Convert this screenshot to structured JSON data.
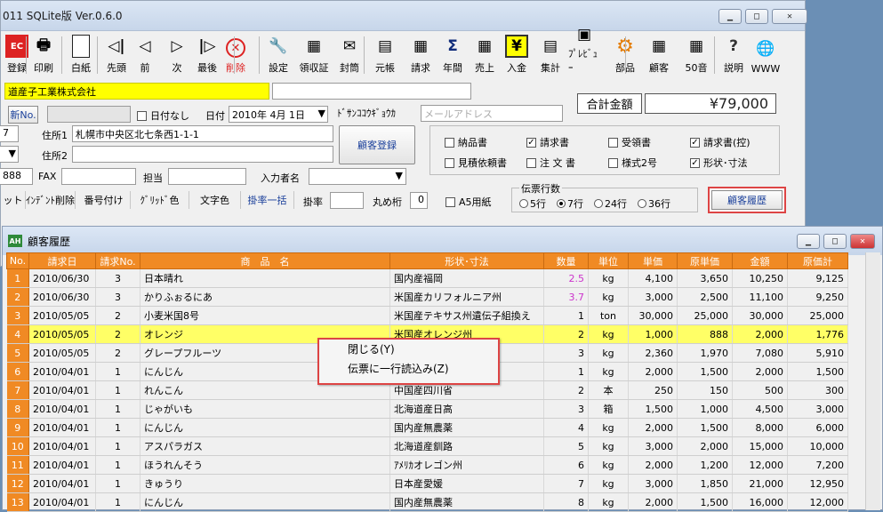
{
  "main_window": {
    "title": "011 SQLite版 Ver.0.6.0",
    "controls": [
      "▁",
      "□",
      "✕"
    ]
  },
  "toolbar": [
    {
      "label": "登録",
      "icon": "ec-register-icon",
      "glyph": "EC"
    },
    {
      "label": "印刷",
      "icon": "printer-icon",
      "glyph": "🖶"
    },
    {
      "label": "白紙",
      "icon": "blank-page-icon",
      "glyph": ""
    },
    {
      "label": "先頭",
      "icon": "first-arrow-icon",
      "glyph": "◁|"
    },
    {
      "label": "前",
      "icon": "prev-arrow-icon",
      "glyph": "◁"
    },
    {
      "label": "次",
      "icon": "next-arrow-icon",
      "glyph": "▷"
    },
    {
      "label": "最後",
      "icon": "last-arrow-icon",
      "glyph": "|▷"
    },
    {
      "label": "削除",
      "icon": "delete-icon",
      "glyph": "✕"
    },
    {
      "label": "設定",
      "icon": "wrench-icon",
      "glyph": "🔧"
    },
    {
      "label": "領収証",
      "icon": "receipt-icon",
      "glyph": "▦"
    },
    {
      "label": "封筒",
      "icon": "envelope-icon",
      "glyph": "✉"
    },
    {
      "label": "元帳",
      "icon": "ledger-icon",
      "glyph": "▤"
    },
    {
      "label": "請求",
      "icon": "invoice-icon",
      "glyph": "▦"
    },
    {
      "label": "年間",
      "icon": "sigma-icon",
      "glyph": "Σ"
    },
    {
      "label": "売上",
      "icon": "sales-icon",
      "glyph": "▦"
    },
    {
      "label": "入金",
      "icon": "yen-icon",
      "glyph": "¥"
    },
    {
      "label": "集計",
      "icon": "total-icon",
      "glyph": "▤"
    },
    {
      "label": "ﾌﾟﾚﾋﾞｭｰ",
      "icon": "preview-icon",
      "glyph": "▣"
    },
    {
      "label": "部品",
      "icon": "gear-icon",
      "glyph": "⚙"
    },
    {
      "label": "顧客",
      "icon": "customer-icon",
      "glyph": "▦"
    },
    {
      "label": "50音",
      "icon": "kana-icon",
      "glyph": "▦"
    },
    {
      "label": "説明",
      "icon": "help-icon",
      "glyph": "?"
    },
    {
      "label": "WWW",
      "icon": "globe-icon",
      "glyph": "🌐"
    }
  ],
  "form": {
    "company": "道産子工業株式会社",
    "company2": "",
    "shinki_btn": "新No.",
    "no_date_label": "日付なし",
    "date_label": "日付",
    "date_value": "2010年 4月 1日",
    "kana": "ﾄﾞｻﾝｺｺｳｷﾞｮｳｶ",
    "email_placeholder": "メールアドレス",
    "total_label": "合計金額",
    "total_value": "¥79,000",
    "postal_partial": "7",
    "addr1_label": "住所1",
    "addr1": "札幌市中央区北七条西1-1-1",
    "addr2_label": "住所2",
    "addr2": "",
    "tel_partial": "888",
    "fax_label": "FAX",
    "tanto_label": "担当",
    "inputter_label": "入力者名",
    "register_customer_btn": "顧客登録",
    "doc_checks": [
      {
        "label": "納品書",
        "checked": false
      },
      {
        "label": "請求書",
        "checked": true
      },
      {
        "label": "受領書",
        "checked": false
      },
      {
        "label": "請求書(控)",
        "checked": true
      },
      {
        "label": "見積依頼書",
        "checked": false
      },
      {
        "label": "注 文 書",
        "checked": false
      },
      {
        "label": "様式2号",
        "checked": false
      },
      {
        "label": "形状･寸法",
        "checked": true
      }
    ],
    "small_buttons": [
      "ット",
      "ｲﾝﾃﾞﾝﾄ削除",
      "番号付け",
      "ｸﾞﾘｯﾄﾞ色",
      "文字色",
      "掛率一括"
    ],
    "rate_label": "掛率",
    "round_label": "丸め桁",
    "round_value": "0",
    "a5_label": "A5用紙",
    "lines_group_label": "伝票行数",
    "lines_options": [
      {
        "label": "5行",
        "selected": false
      },
      {
        "label": "7行",
        "selected": true
      },
      {
        "label": "24行",
        "selected": false
      },
      {
        "label": "36行",
        "selected": false
      }
    ],
    "history_btn": "顧客履歴"
  },
  "history_window": {
    "title": "顧客履歴",
    "app_icon": "AH",
    "columns": [
      "No.",
      "請求日",
      "請求No.",
      "商　品　名",
      "形状･寸法",
      "数量",
      "単位",
      "単価",
      "原単価",
      "金額",
      "原価計"
    ],
    "rows": [
      [
        "1",
        "2010/06/30",
        "3",
        "日本晴れ",
        "国内産福岡",
        "2.5",
        "kg",
        "4,100",
        "3,650",
        "10,250",
        "9,125"
      ],
      [
        "2",
        "2010/06/30",
        "3",
        "かりふぉるにあ",
        "米国産カリフォルニア州",
        "3.7",
        "kg",
        "3,000",
        "2,500",
        "11,100",
        "9,250"
      ],
      [
        "3",
        "2010/05/05",
        "2",
        "小麦米国8号",
        "米国産テキサス州遺伝子組換え",
        "1",
        "ton",
        "30,000",
        "25,000",
        "30,000",
        "25,000"
      ],
      [
        "4",
        "2010/05/05",
        "2",
        "オレンジ",
        "米国産オレンジ州",
        "2",
        "kg",
        "1,000",
        "888",
        "2,000",
        "1,776"
      ],
      [
        "5",
        "2010/05/05",
        "2",
        "グレープフルーツ",
        "",
        "3",
        "kg",
        "2,360",
        "1,970",
        "7,080",
        "5,910"
      ],
      [
        "6",
        "2010/04/01",
        "1",
        "にんじん",
        "",
        "1",
        "kg",
        "2,000",
        "1,500",
        "2,000",
        "1,500"
      ],
      [
        "7",
        "2010/04/01",
        "1",
        "れんこん",
        "中国産四川省",
        "2",
        "本",
        "250",
        "150",
        "500",
        "300"
      ],
      [
        "8",
        "2010/04/01",
        "1",
        "じゃがいも",
        "北海道産日高",
        "3",
        "箱",
        "1,500",
        "1,000",
        "4,500",
        "3,000"
      ],
      [
        "9",
        "2010/04/01",
        "1",
        "にんじん",
        "国内産無農薬",
        "4",
        "kg",
        "2,000",
        "1,500",
        "8,000",
        "6,000"
      ],
      [
        "10",
        "2010/04/01",
        "1",
        "アスパラガス",
        "北海道産釧路",
        "5",
        "kg",
        "3,000",
        "2,000",
        "15,000",
        "10,000"
      ],
      [
        "11",
        "2010/04/01",
        "1",
        "ほうれんそう",
        "ｱﾒﾘｶオレゴン州",
        "6",
        "kg",
        "2,000",
        "1,200",
        "12,000",
        "7,200"
      ],
      [
        "12",
        "2010/04/01",
        "1",
        "きゅうり",
        "日本産愛媛",
        "7",
        "kg",
        "3,000",
        "1,850",
        "21,000",
        "12,950"
      ],
      [
        "13",
        "2010/04/01",
        "1",
        "にんじん",
        "国内産無農薬",
        "8",
        "kg",
        "2,000",
        "1,500",
        "16,000",
        "12,000"
      ]
    ],
    "selected_row": 3,
    "pink_qty_rows": [
      0,
      1
    ]
  },
  "context_menu": {
    "items": [
      "閉じる(Y)",
      "伝票に一行読込み(Z)"
    ]
  },
  "colors": {
    "header_orange": "#f08a24",
    "highlight_yellow": "#ffff66",
    "company_yellow": "#ffff00",
    "accent_red": "#d44444"
  }
}
